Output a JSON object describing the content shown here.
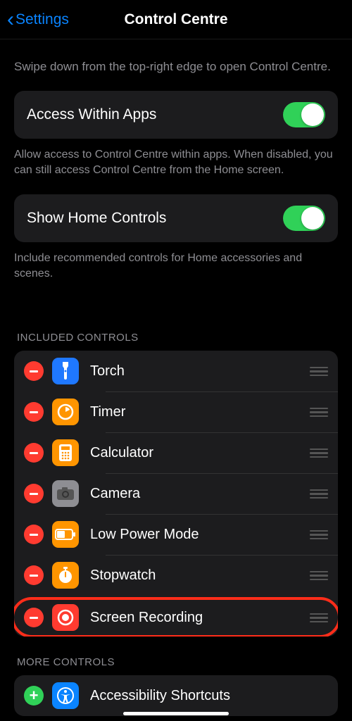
{
  "nav": {
    "back": "Settings",
    "title": "Control Centre"
  },
  "intro": "Swipe down from the top-right edge to open Control Centre.",
  "access": {
    "label": "Access Within Apps",
    "footer": "Allow access to Control Centre within apps. When disabled, you can still access Control Centre from the Home screen."
  },
  "home": {
    "label": "Show Home Controls",
    "footer": "Include recommended controls for Home accessories and scenes."
  },
  "included_header": "INCLUDED CONTROLS",
  "included": [
    {
      "label": "Torch"
    },
    {
      "label": "Timer"
    },
    {
      "label": "Calculator"
    },
    {
      "label": "Camera"
    },
    {
      "label": "Low Power Mode"
    },
    {
      "label": "Stopwatch"
    },
    {
      "label": "Screen Recording"
    }
  ],
  "more_header": "MORE CONTROLS",
  "more": [
    {
      "label": "Accessibility Shortcuts"
    }
  ]
}
